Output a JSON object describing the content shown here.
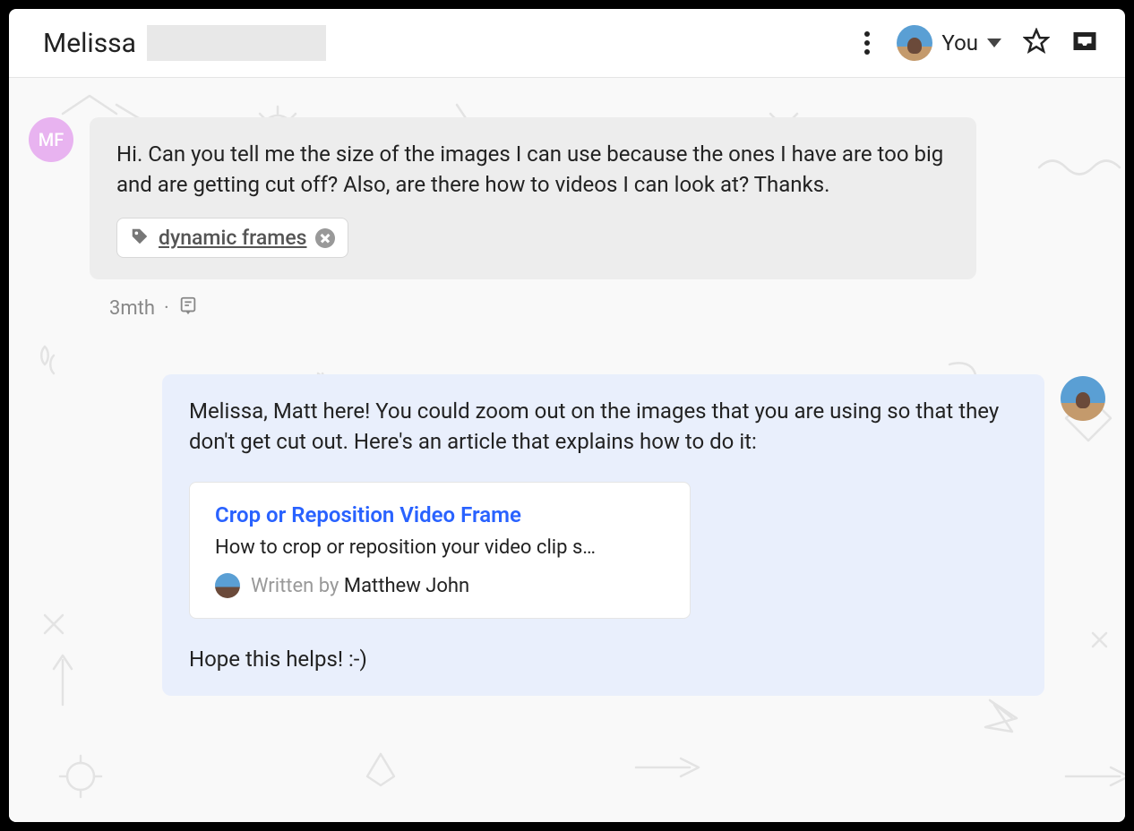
{
  "header": {
    "conversation_name": "Melissa",
    "you_label": "You"
  },
  "customer": {
    "avatar_initials": "MF",
    "message": "Hi. Can you tell me the size of the images I can use because the ones I have are too big and are getting cut off? Also, are there how to videos I can look at? Thanks.",
    "tag": "dynamic frames",
    "timestamp": "3mth"
  },
  "agent": {
    "message_before": "Melissa, Matt here! You could zoom out on the images that you are using so that they don't get cut out. Here's an article that explains how to do it:",
    "message_after": "Hope this helps! :-)",
    "article": {
      "title": "Crop or Reposition Video Frame",
      "description": "How to crop or reposition your video clip s…",
      "written_by_prefix": "Written by ",
      "author": "Matthew John"
    }
  }
}
